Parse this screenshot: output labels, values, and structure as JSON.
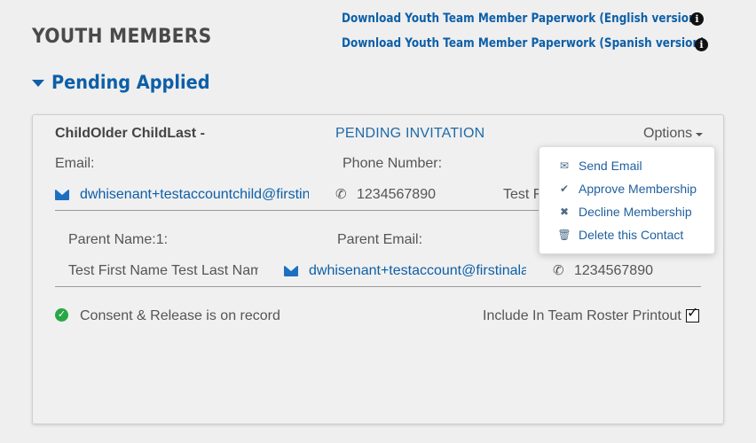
{
  "header": {
    "title": "YOUTH MEMBERS",
    "download_english": "Download Youth Team Member Paperwork (English version)",
    "download_spanish": "Download Youth Team Member Paperwork (Spanish version)",
    "info_glyph": "i"
  },
  "section": {
    "title": "Pending Applied"
  },
  "member": {
    "name": "ChildOlder ChildLast -",
    "status": "PENDING INVITATION",
    "options_label": "Options",
    "email_label": "Email:",
    "email_value": "dwhisenant+testaccountchild@firstinalaska.com",
    "phone_label": "Phone Number:",
    "phone_value": "1234567890",
    "third_value": "Test F"
  },
  "parent": {
    "name_label": "Parent Name:1:",
    "email_label": "Parent Email:",
    "name_value": "Test First Name Test Last Name",
    "email_value": "dwhisenant+testaccount@firstinalaska.com",
    "phone_value": "1234567890"
  },
  "footer": {
    "consent_text": "Consent & Release is on record",
    "roster_label": "Include In Team Roster Printout",
    "roster_checked": true
  },
  "options_menu": {
    "items": [
      {
        "label": "Send Email",
        "icon": "envelope-icon"
      },
      {
        "label": "Approve Membership",
        "icon": "check-icon"
      },
      {
        "label": "Decline Membership",
        "icon": "x-icon"
      },
      {
        "label": "Delete this Contact",
        "icon": "trash-icon"
      }
    ]
  },
  "colors": {
    "link": "#0d5fa8",
    "success": "#27a844",
    "background": "#efefef"
  }
}
